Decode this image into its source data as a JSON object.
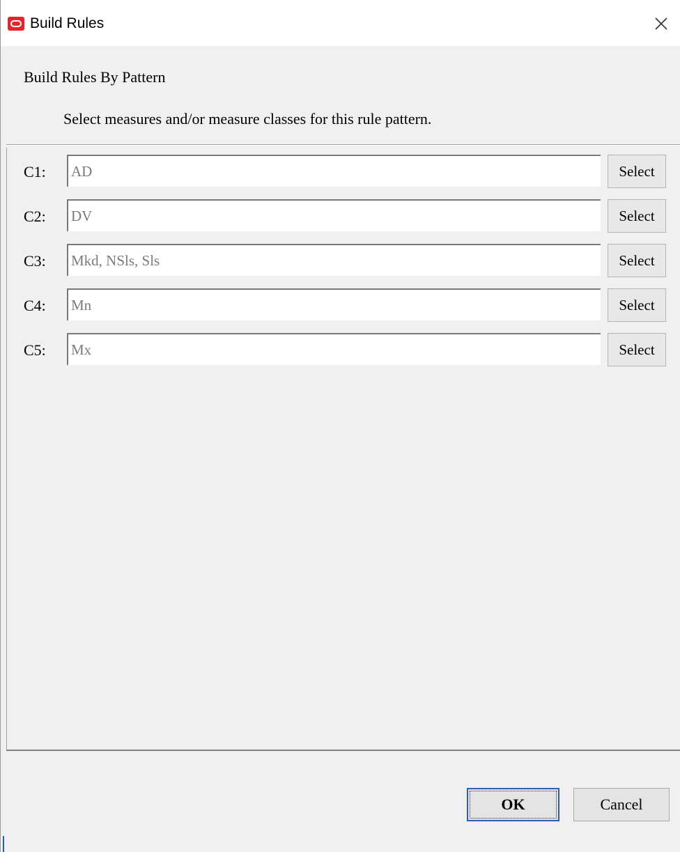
{
  "window": {
    "title": "Build Rules",
    "close_icon": "close-icon",
    "logo_icon": "oracle-logo-icon"
  },
  "header": {
    "title": "Build Rules By Pattern",
    "description": "Select measures and/or measure classes for this rule pattern."
  },
  "rows": [
    {
      "label": "C1:",
      "value": "AD",
      "button": "Select"
    },
    {
      "label": "C2:",
      "value": "DV",
      "button": "Select"
    },
    {
      "label": "C3:",
      "value": "Mkd, NSls, Sls",
      "button": "Select"
    },
    {
      "label": "C4:",
      "value": "Mn",
      "button": "Select"
    },
    {
      "label": "C5:",
      "value": "Mx",
      "button": "Select"
    }
  ],
  "footer": {
    "ok_label": "OK",
    "cancel_label": "Cancel"
  },
  "colors": {
    "logo": "#e4262c",
    "dialog_bg": "#f0f0f0",
    "input_text": "#7a7a7a",
    "default_button_border": "#2c5fb0"
  }
}
